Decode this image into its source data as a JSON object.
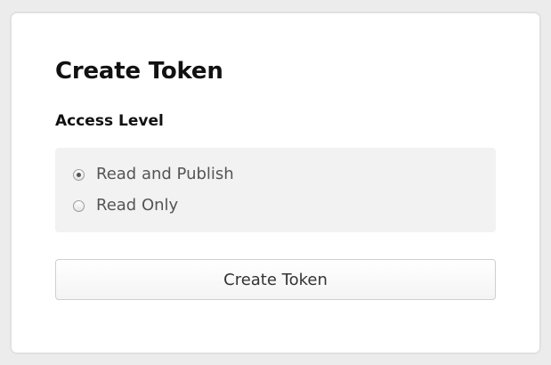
{
  "form": {
    "title": "Create Token",
    "access_level": {
      "label": "Access Level",
      "options": [
        {
          "label": "Read and Publish",
          "checked": true
        },
        {
          "label": "Read Only",
          "checked": false
        }
      ]
    },
    "submit_label": "Create Token"
  }
}
